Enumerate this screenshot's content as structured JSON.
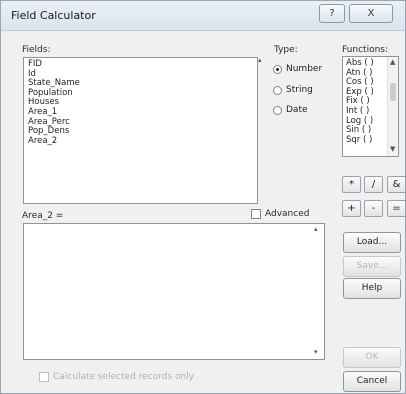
{
  "window": {
    "title": "Field Calculator",
    "help_glyph": "?",
    "close_glyph": "X"
  },
  "fields": {
    "label": "Fields:",
    "items": [
      "FID",
      "Id",
      "State_Name",
      "Population",
      "Houses",
      "Area_1",
      "Area_Perc",
      "Pop_Dens",
      "Area_2"
    ]
  },
  "type": {
    "label": "Type:",
    "options": [
      "Number",
      "String",
      "Date"
    ],
    "selected": "Number"
  },
  "functions": {
    "label": "Functions:",
    "items": [
      "Abs ( )",
      "Atn ( )",
      "Cos ( )",
      "Exp ( )",
      "Fix ( )",
      "Int ( )",
      "Log ( )",
      "Sin ( )",
      "Sqr ( )"
    ]
  },
  "operators": [
    "*",
    "/",
    "&",
    "+",
    "-",
    "="
  ],
  "expression": {
    "label": "Area_2 =",
    "value": ""
  },
  "advanced": {
    "label": "Advanced",
    "checked": false
  },
  "buttons": {
    "load": "Load...",
    "save": "Save...",
    "help": "Help",
    "ok": "OK",
    "cancel": "Cancel"
  },
  "calc_selected": {
    "label": "Calculate selected records only",
    "checked": false
  }
}
